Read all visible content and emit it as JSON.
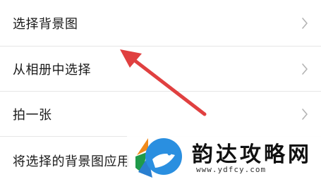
{
  "menu": {
    "items": [
      {
        "label": "选择背景图",
        "icon": "chevron-right-icon"
      },
      {
        "label": "从相册中选择",
        "icon": "chevron-right-icon"
      },
      {
        "label": "拍一张",
        "icon": "chevron-right-icon"
      },
      {
        "label": "将选择的背景图应用",
        "icon": "chevron-right-icon"
      }
    ]
  },
  "watermark": {
    "title": "韵达攻略网",
    "url": "www.ydfcy.com"
  },
  "colors": {
    "arrow": "#e04040",
    "divider": "#e6e6e6",
    "chevron": "#b3b3b3"
  }
}
